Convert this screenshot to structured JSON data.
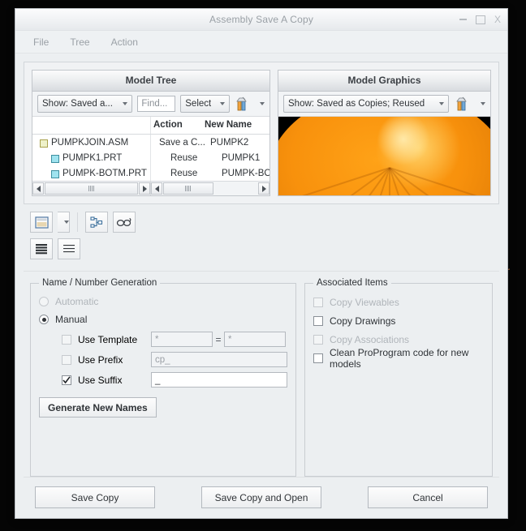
{
  "window": {
    "title": "Assembly Save A Copy",
    "controls": {
      "minimize": "minimize-icon",
      "maximize": "maximize-icon",
      "close": "X"
    }
  },
  "menubar": {
    "items": [
      "File",
      "Tree",
      "Action"
    ]
  },
  "tree_panel": {
    "header": "Model Tree",
    "show_combo": "Show: Saved a...",
    "find_placeholder": "Find...",
    "select_button": "Select",
    "tools_icon": "tools-icon",
    "columns": [
      "",
      "Action",
      "New Name"
    ],
    "rows": [
      {
        "icon": "assembly-icon",
        "name": "PUMPKJOIN.ASM",
        "action": "Save a C...",
        "new_name": "PUMPK2",
        "level": 1
      },
      {
        "icon": "part-icon",
        "name": "PUMPK1.PRT",
        "action": "Reuse",
        "new_name": "PUMPK1",
        "level": 2
      },
      {
        "icon": "part-icon",
        "name": "PUMPK-BOTM.PRT",
        "action": "Reuse",
        "new_name": "PUMPK-BOTM",
        "level": 2
      }
    ]
  },
  "graphics_panel": {
    "header": "Model Graphics",
    "show_combo": "Show: Saved as Copies; Reused",
    "tools_icon": "tools-icon",
    "model": "orange-pumpkin-3d-model"
  },
  "toolbar": {
    "row1": [
      {
        "name": "panel-layout-button",
        "icon": "panel-layout-icon"
      },
      {
        "name": "panel-layout-dropdown",
        "icon": "chevron-down-icon"
      },
      {
        "name": "tree-structure-button",
        "icon": "node-tree-icon"
      },
      {
        "name": "glasses-button",
        "icon": "glasses-icon"
      }
    ],
    "row2": [
      {
        "name": "list-dense-button",
        "icon": "list-filled-icon"
      },
      {
        "name": "list-sparse-button",
        "icon": "list-lines-icon"
      }
    ]
  },
  "name_generation": {
    "legend": "Name / Number Generation",
    "automatic_label": "Automatic",
    "automatic_selected": false,
    "automatic_enabled": false,
    "manual_label": "Manual",
    "manual_selected": true,
    "options": [
      {
        "label": "Use Template",
        "checked": false,
        "enabled": false,
        "value": "*",
        "value2": "*",
        "separator": "="
      },
      {
        "label": "Use Prefix",
        "checked": false,
        "enabled": false,
        "value": "cp_"
      },
      {
        "label": "Use Suffix",
        "checked": true,
        "enabled": true,
        "value": "_"
      }
    ],
    "generate_button": "Generate New Names"
  },
  "associated_items": {
    "legend": "Associated Items",
    "items": [
      {
        "label": "Copy Viewables",
        "checked": false,
        "enabled": false
      },
      {
        "label": "Copy Drawings",
        "checked": false,
        "enabled": true
      },
      {
        "label": "Copy Associations",
        "checked": false,
        "enabled": false
      },
      {
        "label": "Clean ProProgram code for new models",
        "checked": false,
        "enabled": true
      }
    ]
  },
  "footer": {
    "buttons": [
      "Save Copy",
      "Save Copy and Open",
      "Cancel"
    ]
  },
  "colors": {
    "accent_orange": "#f8910c",
    "dialog_bg": "#eceff1",
    "desktop_bg": "#050505",
    "wireframe": "#d2793c"
  }
}
